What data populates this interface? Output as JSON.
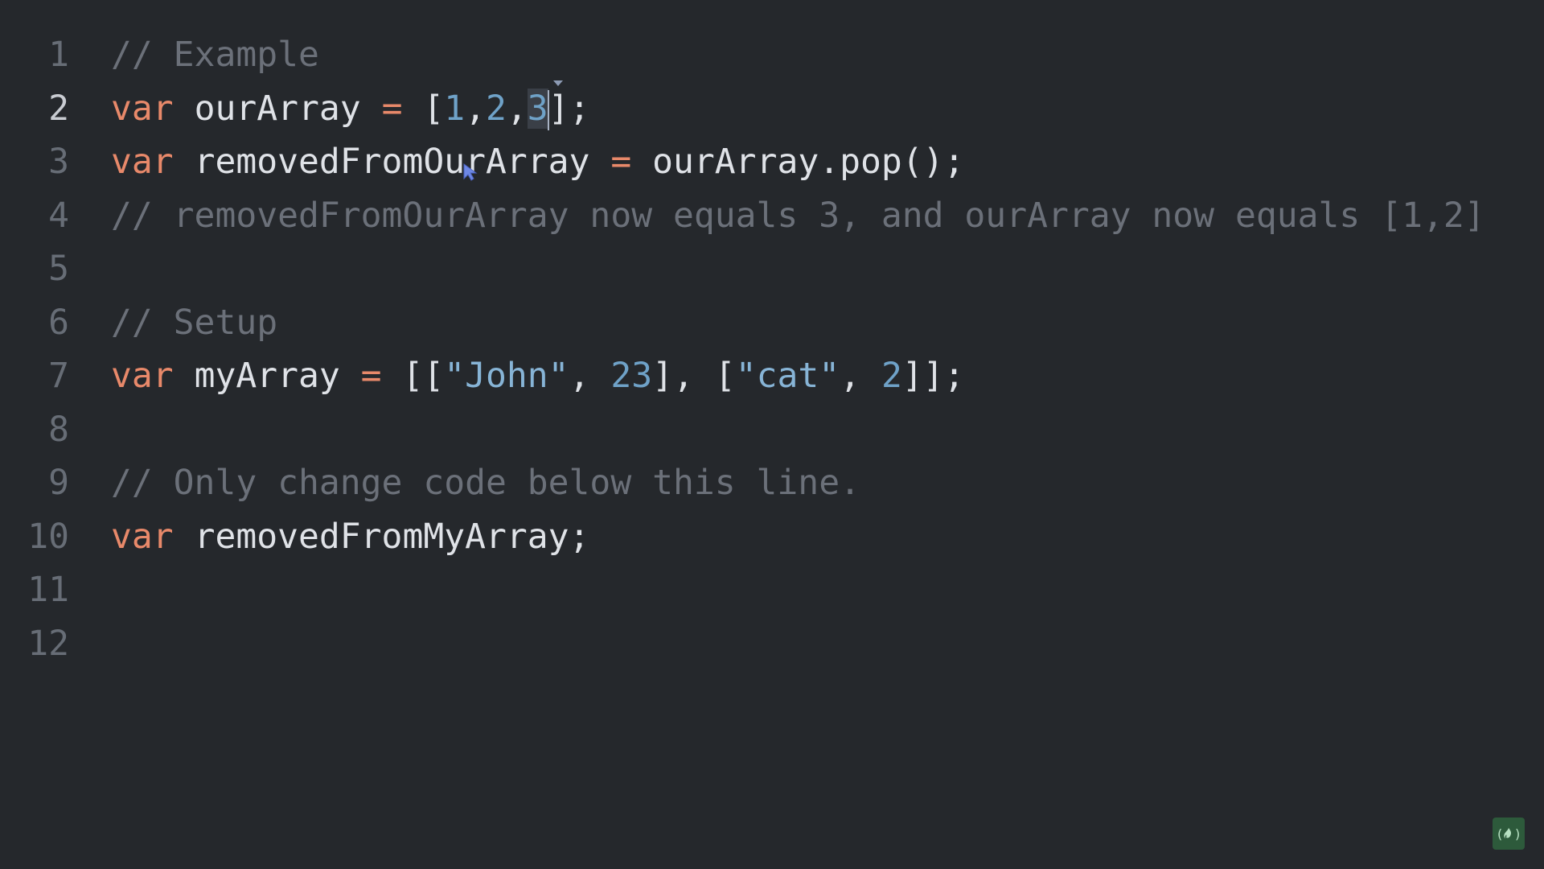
{
  "editor": {
    "lines": [
      {
        "num": "1",
        "tokens": [
          {
            "t": "// Example",
            "k": "cm"
          }
        ]
      },
      {
        "num": "2",
        "active": true,
        "tokens": [
          {
            "t": "var",
            "k": "kw"
          },
          {
            "t": " ",
            "k": "punc"
          },
          {
            "t": "ourArray",
            "k": "id"
          },
          {
            "t": " ",
            "k": "punc"
          },
          {
            "t": "=",
            "k": "op"
          },
          {
            "t": " [",
            "k": "punc"
          },
          {
            "t": "1",
            "k": "num"
          },
          {
            "t": ",",
            "k": "punc"
          },
          {
            "t": "2",
            "k": "num"
          },
          {
            "t": ",",
            "k": "punc"
          },
          {
            "t": "3",
            "k": "num",
            "sel": true
          },
          {
            "caret": true
          },
          {
            "t": "];",
            "k": "punc"
          }
        ]
      },
      {
        "num": "3",
        "tokens": [
          {
            "t": "var",
            "k": "kw"
          },
          {
            "t": " ",
            "k": "punc"
          },
          {
            "t": "removedFromOurArray",
            "k": "id"
          },
          {
            "t": " ",
            "k": "punc"
          },
          {
            "t": "=",
            "k": "op"
          },
          {
            "t": " ",
            "k": "punc"
          },
          {
            "t": "ourArray.pop();",
            "k": "id"
          }
        ]
      },
      {
        "num": "4",
        "tokens": [
          {
            "t": "// removedFromOurArray now equals 3, and ourArray now equals [1,2]",
            "k": "cm"
          }
        ]
      },
      {
        "num": "5",
        "tokens": []
      },
      {
        "num": "6",
        "tokens": [
          {
            "t": "// Setup",
            "k": "cm"
          }
        ]
      },
      {
        "num": "7",
        "tokens": [
          {
            "t": "var",
            "k": "kw"
          },
          {
            "t": " ",
            "k": "punc"
          },
          {
            "t": "myArray",
            "k": "id"
          },
          {
            "t": " ",
            "k": "punc"
          },
          {
            "t": "=",
            "k": "op"
          },
          {
            "t": " [[",
            "k": "punc"
          },
          {
            "t": "\"John\"",
            "k": "str"
          },
          {
            "t": ", ",
            "k": "punc"
          },
          {
            "t": "23",
            "k": "num"
          },
          {
            "t": "], [",
            "k": "punc"
          },
          {
            "t": "\"cat\"",
            "k": "str"
          },
          {
            "t": ", ",
            "k": "punc"
          },
          {
            "t": "2",
            "k": "num"
          },
          {
            "t": "]];",
            "k": "punc"
          }
        ]
      },
      {
        "num": "8",
        "tokens": []
      },
      {
        "num": "9",
        "tokens": [
          {
            "t": "// Only change code below this line.",
            "k": "cm"
          }
        ]
      },
      {
        "num": "10",
        "tokens": [
          {
            "t": "var",
            "k": "kw"
          },
          {
            "t": " ",
            "k": "punc"
          },
          {
            "t": "removedFromMyArray;",
            "k": "id"
          }
        ]
      },
      {
        "num": "11",
        "tokens": []
      },
      {
        "num": "12",
        "tokens": []
      }
    ]
  },
  "colors": {
    "background": "#25282c",
    "keyword": "#e8896a",
    "number": "#6fa2c8",
    "string": "#87b4d6",
    "comment": "#6b7079",
    "text": "#dfe2e7",
    "gutter": "#676d76"
  },
  "logo": {
    "icon": "freecodecamp-fire-icon",
    "glyph": "(🔥)"
  }
}
